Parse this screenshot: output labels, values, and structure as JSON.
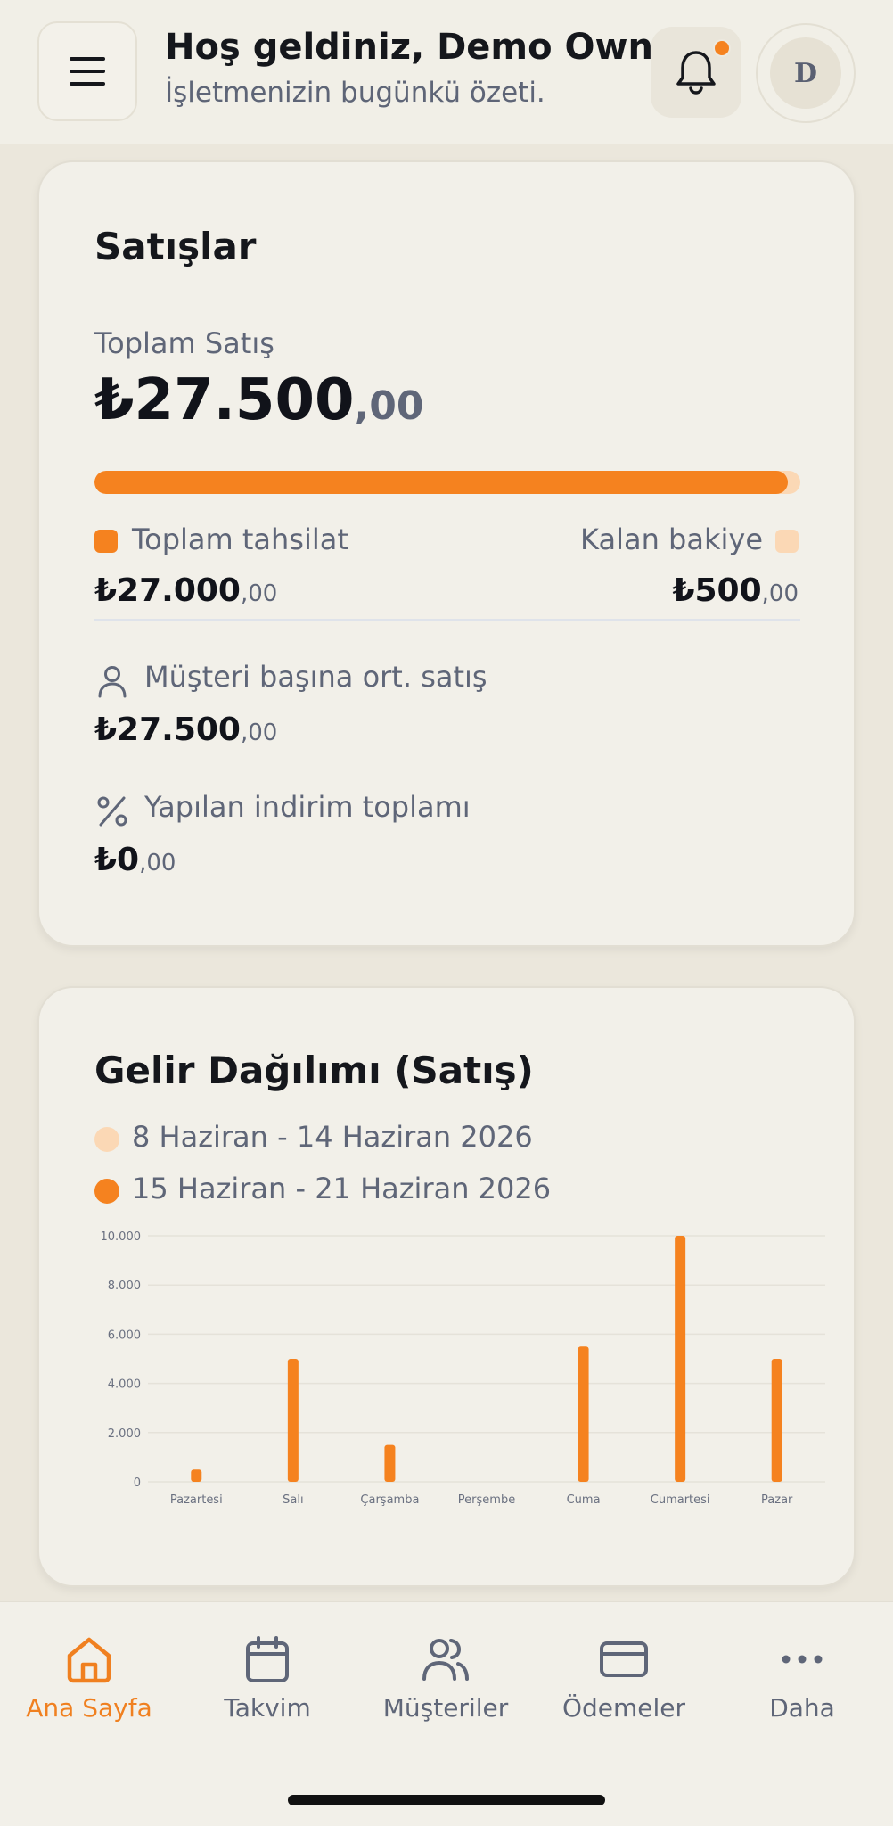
{
  "header": {
    "title": "Hoş geldiniz, Demo Owner",
    "subtitle": "İşletmenizin bugünkü özeti.",
    "avatar_initial": "D"
  },
  "sales": {
    "title": "Satışlar",
    "total_label": "Toplam Satış",
    "total_main": "₺27.500",
    "total_dec": ",00",
    "collected_fraction": 0.982,
    "collected_label": "Toplam tahsilat",
    "collected_main": "₺27.000",
    "collected_dec": ",00",
    "remaining_label": "Kalan bakiye",
    "remaining_main": "₺500",
    "remaining_dec": ",00",
    "avg_label": "Müşteri başına ort. satış",
    "avg_main": "₺27.500",
    "avg_dec": ",00",
    "discount_label": "Yapılan indirim toplamı",
    "discount_main": "₺0",
    "discount_dec": ",00"
  },
  "income": {
    "title": "Gelir Dağılımı (Satış)",
    "legend_prev": "8 Haziran - 14 Haziran 2026",
    "legend_curr": "15 Haziran - 21 Haziran 2026"
  },
  "chart_data": {
    "type": "bar",
    "categories": [
      "Pazartesi",
      "Salı",
      "Çarşamba",
      "Perşembe",
      "Cuma",
      "Cumartesi",
      "Pazar"
    ],
    "series": [
      {
        "name": "8 Haziran - 14 Haziran 2026",
        "values": [
          0,
          0,
          0,
          0,
          0,
          0,
          0
        ],
        "color": "#fbd8b5"
      },
      {
        "name": "15 Haziran - 21 Haziran 2026",
        "values": [
          500,
          5000,
          1500,
          0,
          5500,
          10000,
          5000
        ],
        "color": "#f5821f"
      }
    ],
    "yticks": [
      "0",
      "2.000",
      "4.000",
      "6.000",
      "8.000",
      "10.000"
    ],
    "ylim": [
      0,
      10000
    ],
    "grid": true
  },
  "colors": {
    "accent": "#f5821f",
    "accent_light": "#fbd8b5",
    "muted_text": "#5f6678"
  },
  "nav": {
    "items": [
      {
        "label": "Ana Sayfa",
        "icon": "home-icon",
        "active": true
      },
      {
        "label": "Takvim",
        "icon": "calendar-icon"
      },
      {
        "label": "Müşteriler",
        "icon": "users-icon"
      },
      {
        "label": "Ödemeler",
        "icon": "credit-card-icon"
      },
      {
        "label": "Daha",
        "icon": "more-icon"
      }
    ]
  }
}
